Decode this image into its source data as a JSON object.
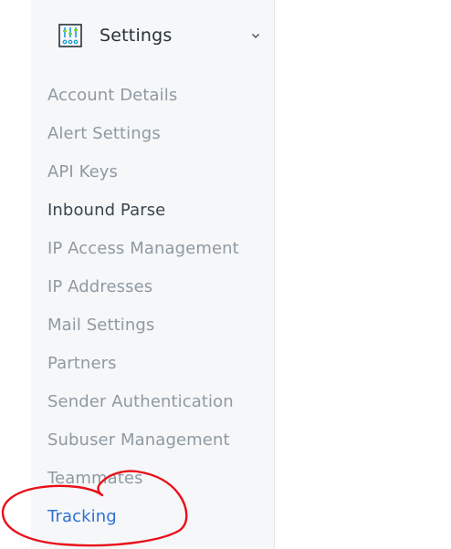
{
  "sidebar": {
    "header": {
      "title": "Settings",
      "icon": "settings-sliders-icon",
      "expand_icon": "chevron-down-icon"
    },
    "items": [
      {
        "label": "Account Details"
      },
      {
        "label": "Alert Settings"
      },
      {
        "label": "API Keys"
      },
      {
        "label": "Inbound Parse"
      },
      {
        "label": "IP Access Management"
      },
      {
        "label": "IP Addresses"
      },
      {
        "label": "Mail Settings"
      },
      {
        "label": "Partners"
      },
      {
        "label": "Sender Authentication"
      },
      {
        "label": "Subuser Management"
      },
      {
        "label": "Teammates"
      },
      {
        "label": "Tracking"
      }
    ],
    "active_item": "Tracking"
  },
  "colors": {
    "sidebar_bg": "#f6f7f8",
    "item_text": "#8e9aa3",
    "item_text_dark": "#3a4650",
    "active_text": "#2f70d4",
    "annotation_circle": "#e8101a"
  }
}
